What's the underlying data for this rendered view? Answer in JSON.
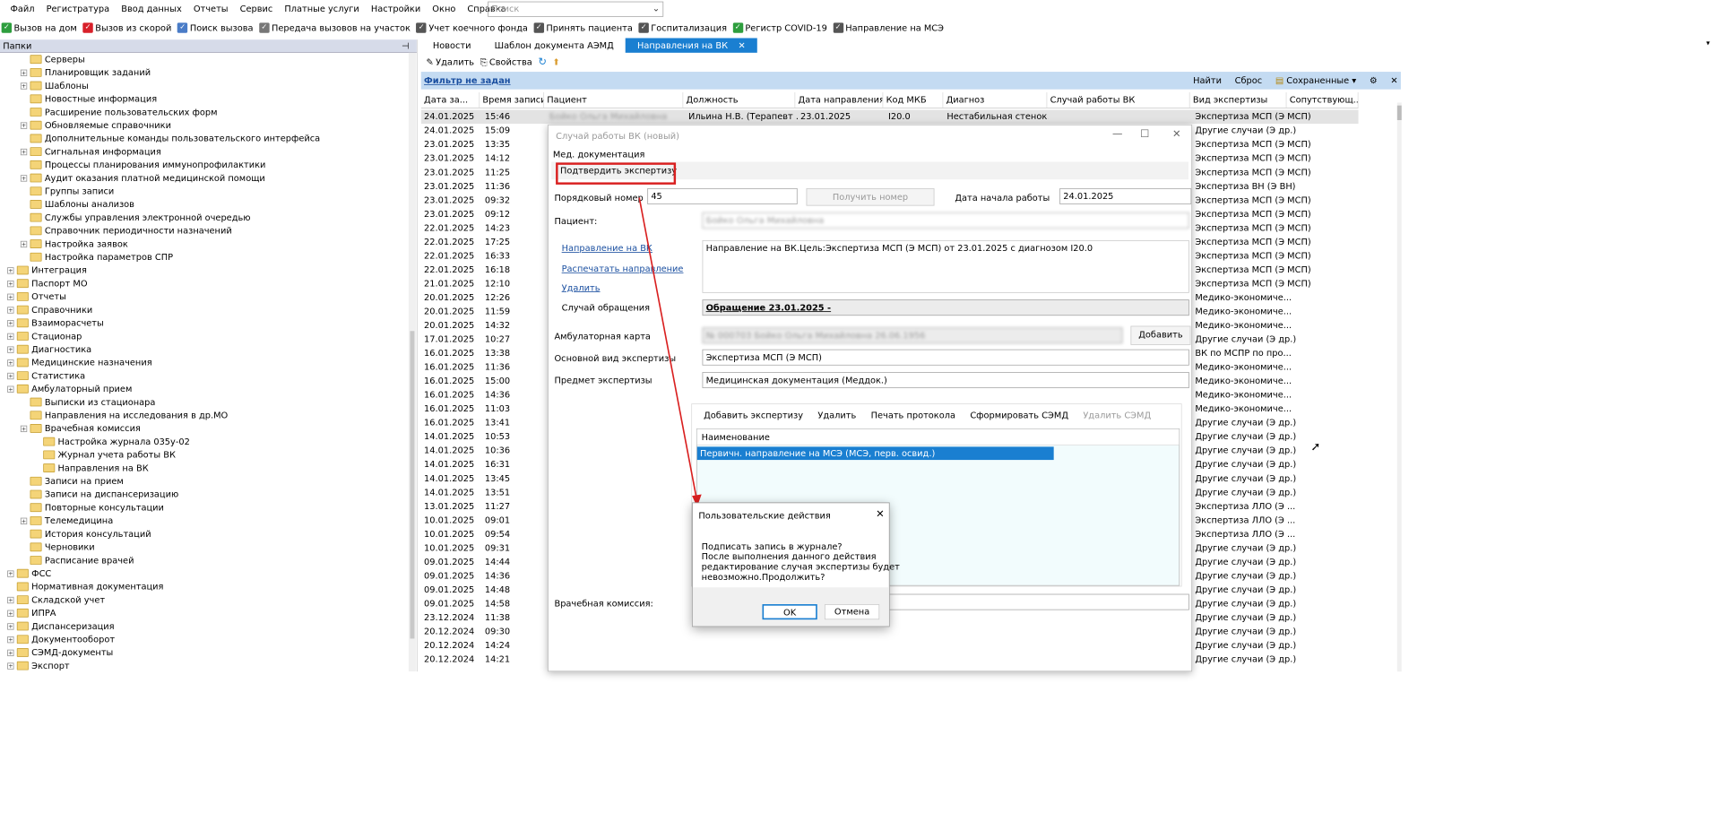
{
  "menu": [
    "Файл",
    "Регистратура",
    "Ввод данных",
    "Отчеты",
    "Сервис",
    "Платные услуги",
    "Настройки",
    "Окно",
    "Справка"
  ],
  "search_placeholder": "Поиск",
  "toolbar": [
    {
      "label": "Вызов на дом",
      "icon": "check-icon",
      "color": "#2e9e3e"
    },
    {
      "label": "Вызов из скорой",
      "icon": "check-icon",
      "color": "#d8202a"
    },
    {
      "label": "Поиск вызова",
      "icon": "search-icon",
      "color": "#4a7cc7"
    },
    {
      "label": "Передача вызовов на участок",
      "icon": "transfer-icon",
      "color": "#777"
    },
    {
      "label": "Учет коечного фонда",
      "icon": "bed-icon",
      "color": "#555"
    },
    {
      "label": "Принять пациента",
      "icon": "user-icon",
      "color": "#555"
    },
    {
      "label": "Госпитализация",
      "icon": "ambulance-icon",
      "color": "#555"
    },
    {
      "label": "Регистр COVID-19",
      "icon": "virus-icon",
      "color": "#2e9e3e"
    },
    {
      "label": "Направление на МСЭ",
      "icon": "doc-icon",
      "color": "#555"
    }
  ],
  "folders_header": "Папки",
  "tree": [
    {
      "label": "Серверы",
      "level": 2,
      "exp": false
    },
    {
      "label": "Планировщик заданий",
      "level": 2,
      "exp": true
    },
    {
      "label": "Шаблоны",
      "level": 2,
      "exp": true
    },
    {
      "label": "Новостные информация",
      "level": 2,
      "exp": false
    },
    {
      "label": "Расширение пользовательских форм",
      "level": 2,
      "exp": false
    },
    {
      "label": "Обновляемые справочники",
      "level": 2,
      "exp": true
    },
    {
      "label": "Дополнительные команды пользовательского интерфейса",
      "level": 2,
      "exp": false
    },
    {
      "label": "Сигнальная информация",
      "level": 2,
      "exp": true
    },
    {
      "label": "Процессы планирования иммунопрофилактики",
      "level": 2,
      "exp": false
    },
    {
      "label": "Аудит оказания платной медицинской помощи",
      "level": 2,
      "exp": true
    },
    {
      "label": "Группы записи",
      "level": 2,
      "exp": false
    },
    {
      "label": "Шаблоны анализов",
      "level": 2,
      "exp": false
    },
    {
      "label": "Службы управления электронной очередью",
      "level": 2,
      "exp": false
    },
    {
      "label": "Справочник периодичности назначений",
      "level": 2,
      "exp": false
    },
    {
      "label": "Настройка заявок",
      "level": 2,
      "exp": true
    },
    {
      "label": "Настройка параметров СПР",
      "level": 2,
      "exp": false
    },
    {
      "label": "Интеграция",
      "level": 1,
      "exp": true
    },
    {
      "label": "Паспорт МО",
      "level": 1,
      "exp": true
    },
    {
      "label": "Отчеты",
      "level": 1,
      "exp": true
    },
    {
      "label": "Справочники",
      "level": 1,
      "exp": true
    },
    {
      "label": "Взаиморасчеты",
      "level": 1,
      "exp": true
    },
    {
      "label": "Стационар",
      "level": 1,
      "exp": true
    },
    {
      "label": "Диагностика",
      "level": 1,
      "exp": true
    },
    {
      "label": "Медицинские назначения",
      "level": 1,
      "exp": true
    },
    {
      "label": "Статистика",
      "level": 1,
      "exp": true
    },
    {
      "label": "Амбулаторный прием",
      "level": 1,
      "exp": true
    },
    {
      "label": "Выписки из стационара",
      "level": 2,
      "exp": false
    },
    {
      "label": "Направления на исследования в др.МО",
      "level": 2,
      "exp": false
    },
    {
      "label": "Врачебная комиссия",
      "level": 2,
      "exp": true
    },
    {
      "label": "Настройка журнала 035у-02",
      "level": 3,
      "exp": false
    },
    {
      "label": "Журнал учета работы ВК",
      "level": 3,
      "exp": false
    },
    {
      "label": "Направления на ВК",
      "level": 3,
      "exp": false
    },
    {
      "label": "Записи на прием",
      "level": 2,
      "exp": false
    },
    {
      "label": "Записи на диспансеризацию",
      "level": 2,
      "exp": false
    },
    {
      "label": "Повторные консультации",
      "level": 2,
      "exp": false
    },
    {
      "label": "Телемедицина",
      "level": 2,
      "exp": true
    },
    {
      "label": "История консультаций",
      "level": 2,
      "exp": false
    },
    {
      "label": "Черновики",
      "level": 2,
      "exp": false
    },
    {
      "label": "Расписание врачей",
      "level": 2,
      "exp": false
    },
    {
      "label": "ФСС",
      "level": 1,
      "exp": true
    },
    {
      "label": "Нормативная документация",
      "level": 1,
      "exp": false
    },
    {
      "label": "Складской учет",
      "level": 1,
      "exp": true
    },
    {
      "label": "ИПРА",
      "level": 1,
      "exp": true
    },
    {
      "label": "Диспансеризация",
      "level": 1,
      "exp": true
    },
    {
      "label": "Документооборот",
      "level": 1,
      "exp": true
    },
    {
      "label": "СЭМД-документы",
      "level": 1,
      "exp": true
    },
    {
      "label": "Экспорт",
      "level": 1,
      "exp": true
    }
  ],
  "tabs": [
    {
      "label": "Новости",
      "active": false
    },
    {
      "label": "Шаблон документа АЭМД",
      "active": false
    },
    {
      "label": "Направления на ВК",
      "active": true
    }
  ],
  "doc_toolbar": {
    "delete": "Удалить",
    "props": "Свойства"
  },
  "filter": {
    "text": "Фильтр не задан",
    "find": "Найти",
    "reset": "Сброс",
    "saved": "Сохраненные"
  },
  "columns": [
    "Дата за...",
    "Время записи",
    "Пациент",
    "Должность",
    "Дата направления",
    "Код МКБ",
    "Диагноз",
    "Случай работы ВК",
    "Вид экспертизы",
    "Сопутствующ..."
  ],
  "first_row": {
    "date": "24.01.2025",
    "time": "15:46",
    "patient": "Бойко Ольга Михайловна",
    "doctor": "Ильина Н.В. (Терапевт ...",
    "ndate": "23.01.2025",
    "mkb": "I20.0",
    "diag": "Нестабильная стенок...",
    "type": "Экспертиза МСП (Э МСП)"
  },
  "rows": [
    [
      "24.01.2025",
      "15:09",
      "Другие случаи (Э др.)"
    ],
    [
      "23.01.2025",
      "13:35",
      "Экспертиза МСП (Э МСП)"
    ],
    [
      "23.01.2025",
      "14:12",
      "Экспертиза МСП (Э МСП)"
    ],
    [
      "23.01.2025",
      "11:25",
      "Экспертиза МСП (Э МСП)"
    ],
    [
      "23.01.2025",
      "11:36",
      "Экспертиза ВН (Э ВН)"
    ],
    [
      "23.01.2025",
      "09:32",
      "Экспертиза МСП (Э МСП)"
    ],
    [
      "23.01.2025",
      "09:12",
      "Экспертиза МСП (Э МСП)"
    ],
    [
      "22.01.2025",
      "14:23",
      "Экспертиза МСП (Э МСП)"
    ],
    [
      "22.01.2025",
      "17:25",
      "Экспертиза МСП (Э МСП)"
    ],
    [
      "22.01.2025",
      "16:33",
      "Экспертиза МСП (Э МСП)"
    ],
    [
      "22.01.2025",
      "16:18",
      "Экспертиза МСП (Э МСП)"
    ],
    [
      "21.01.2025",
      "12:10",
      "Экспертиза МСП (Э МСП)"
    ],
    [
      "20.01.2025",
      "12:26",
      "Медико-экономиче..."
    ],
    [
      "20.01.2025",
      "11:59",
      "Медико-экономиче..."
    ],
    [
      "20.01.2025",
      "14:32",
      "Медико-экономиче..."
    ],
    [
      "17.01.2025",
      "10:27",
      "Другие случаи (Э др.)"
    ],
    [
      "16.01.2025",
      "13:38",
      "ВК по МСПР по про..."
    ],
    [
      "16.01.2025",
      "11:36",
      "Медико-экономиче..."
    ],
    [
      "16.01.2025",
      "15:00",
      "Медико-экономиче..."
    ],
    [
      "16.01.2025",
      "14:36",
      "Медико-экономиче..."
    ],
    [
      "16.01.2025",
      "11:03",
      "Медико-экономиче..."
    ],
    [
      "16.01.2025",
      "13:41",
      "Другие случаи (Э др.)"
    ],
    [
      "14.01.2025",
      "10:53",
      "Другие случаи (Э др.)"
    ],
    [
      "14.01.2025",
      "10:36",
      "Другие случаи (Э др.)"
    ],
    [
      "14.01.2025",
      "16:31",
      "Другие случаи (Э др.)"
    ],
    [
      "14.01.2025",
      "13:45",
      "Другие случаи (Э др.)"
    ],
    [
      "14.01.2025",
      "13:51",
      "Другие случаи (Э др.)"
    ],
    [
      "13.01.2025",
      "11:27",
      "Экспертиза ЛЛО (Э ..."
    ],
    [
      "10.01.2025",
      "09:01",
      "Экспертиза ЛЛО (Э ..."
    ],
    [
      "10.01.2025",
      "09:54",
      "Экспертиза ЛЛО (Э ..."
    ],
    [
      "10.01.2025",
      "09:31",
      "Другие случаи (Э др.)"
    ],
    [
      "09.01.2025",
      "14:44",
      "Другие случаи (Э др.)"
    ],
    [
      "09.01.2025",
      "14:36",
      "Другие случаи (Э др.)"
    ],
    [
      "09.01.2025",
      "14:48",
      "Другие случаи (Э др.)"
    ],
    [
      "09.01.2025",
      "14:58",
      "Другие случаи (Э др.)"
    ],
    [
      "23.12.2024",
      "11:38",
      "Другие случаи (Э др.)"
    ],
    [
      "20.12.2024",
      "09:30",
      "Другие случаи (Э др.)"
    ],
    [
      "20.12.2024",
      "14:24",
      "Другие случаи (Э др.)"
    ],
    [
      "20.12.2024",
      "14:21",
      "Другие случаи (Э др.)"
    ]
  ],
  "dialog": {
    "title": "Случай работы ВК (новый)",
    "tab": "Мед. документация",
    "confirm": "Подтвердить экспертизу",
    "num_label": "Порядковый номер",
    "num_value": "45",
    "get_num": "Получить номер",
    "start_label": "Дата начала работы",
    "start_value": "24.01.2025",
    "patient_label": "Пациент:",
    "patient_value": "Бойко Ольга Михайловна",
    "link1": "Направление на ВК",
    "link2": "Распечатать направление",
    "link3": "Удалить",
    "direction_text": "Направление на ВК.Цель:Экспертиза МСП (Э МСП) от 23.01.2025 с диагнозом I20.0",
    "case_label": "Случай обращения",
    "case_value": "Обращение 23.01.2025 -",
    "card_label": "Амбулаторная карта",
    "card_value": "№ 000703 Бойко Ольга Михайловна 26.06.1956",
    "add": "Добавить",
    "kind_label": "Основной вид экспертизы",
    "kind_value": "Экспертиза МСП (Э МСП)",
    "subject_label": "Предмет экспертизы",
    "subject_value": "Медицинская документация (Меддок.)",
    "sub_toolbar": [
      "Добавить экспертизу",
      "Удалить",
      "Печать протокола",
      "Сформировать СЭМД",
      "Удалить СЭМД"
    ],
    "col_name": "Наименование",
    "row_value": "Первичн. направление на МСЭ (МСЭ, перв. освид.)",
    "commission_label": "Врачебная комиссия:"
  },
  "popup": {
    "title": "Пользовательские действия",
    "line1": "Подписать запись в журнале?",
    "line2": "После выполнения данного действия",
    "line3": "редактирование случая экспертизы будет",
    "line4": "невозможно.Продолжить?",
    "ok": "OK",
    "cancel": "Отмена"
  }
}
